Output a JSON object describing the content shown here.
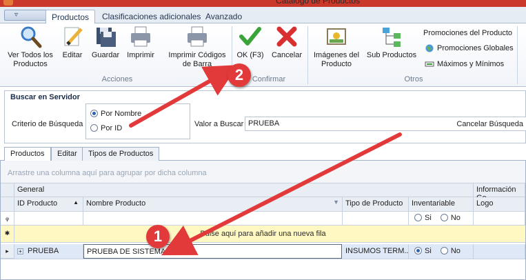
{
  "window": {
    "title": "Catalogo de Productos"
  },
  "ribbon": {
    "tabs": [
      "Productos",
      "Clasificaciones adicionales",
      "Avanzado"
    ],
    "active_tab": "Productos",
    "buttons": {
      "ver_todos": "Ver Todos los Productos",
      "editar": "Editar",
      "guardar": "Guardar",
      "imprimir": "Imprimir",
      "imprimir_codigos": "Imprimir Códigos de Barra",
      "ok": "OK (F3)",
      "cancelar": "Cancelar",
      "imagenes": "Imágenes del Producto",
      "sub_productos": "Sub Productos",
      "promociones_producto": "Promociones del Producto",
      "promociones_globales": "Promociones Globales",
      "maximos_minimos": "Máximos y Mínimos"
    },
    "groups": {
      "acciones": "Acciones",
      "confirmar": "Confirmar",
      "otros": "Otros"
    }
  },
  "search": {
    "title": "Buscar en Servidor",
    "criteria_label": "Criterio de Búsqueda",
    "options": [
      "Por Nombre",
      "Por ID"
    ],
    "selected_option": "Por Nombre",
    "value_label": "Valor a Buscar",
    "value": "PRUEBA",
    "cancel_label": "Cancelar Búsqueda"
  },
  "lower_tabs": [
    "Productos",
    "Editar",
    "Tipos de Productos"
  ],
  "grid": {
    "group_hint": "Arrastre una columna aquí para agrupar por dicha columna",
    "bands": {
      "general": "General",
      "info": "Información Ge"
    },
    "columns": [
      "ID Producto",
      "Nombre Producto",
      "Tipo de Producto",
      "Inventariable",
      "Logo"
    ],
    "filter_radio": {
      "si": "Si",
      "no": "No"
    },
    "new_row_text": "Pulse aquí para añadir una nueva fila",
    "rows": [
      {
        "id": "PRUEBA",
        "nombre": "PRUEBA DE SISTEMA",
        "tipo": "INSUMOS TERM...",
        "inventariable": "Si",
        "si": "Si",
        "no": "No"
      }
    ]
  },
  "annotations": {
    "badge_1": "1",
    "badge_2": "2"
  },
  "colors": {
    "accent": "#e23a3a",
    "selection": "#dfe8f7",
    "new_row": "#fff8c2"
  }
}
